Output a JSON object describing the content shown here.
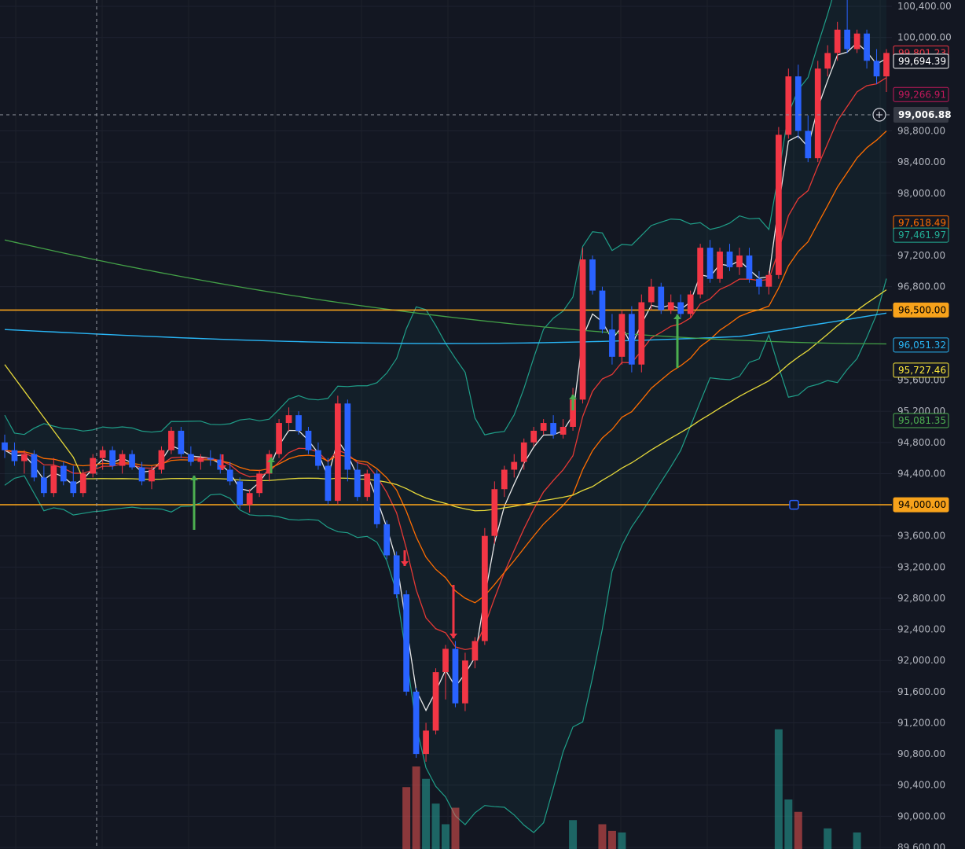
{
  "chart_data": {
    "type": "candlestick",
    "y_axis": {
      "min": 89600,
      "max": 100500,
      "ticks": [
        "100,400.00",
        "100,000.00",
        "98,800.00",
        "98,400.00",
        "98,000.00",
        "97,200.00",
        "96,800.00",
        "95,600.00",
        "95,200.00",
        "94,800.00",
        "94,400.00",
        "93,600.00",
        "93,200.00",
        "92,800.00",
        "92,400.00",
        "92,000.00",
        "91,600.00",
        "91,200.00",
        "90,800.00",
        "90,400.00",
        "90,000.00",
        "89,600.00"
      ]
    },
    "crosshair": {
      "price": "99,006.88",
      "value": 99006.88
    },
    "horizontal_lines": [
      {
        "label": "96,500.00",
        "value": 96500,
        "color": "#f7a21b"
      },
      {
        "label": "94,000.00",
        "value": 94000,
        "color": "#f7a21b"
      }
    ],
    "price_tags": [
      {
        "label": "99,801.23",
        "value": 99801.23,
        "color": "#f23645",
        "style": "outline"
      },
      {
        "label": "99,694.39",
        "value": 99694.39,
        "color": "#ffffff",
        "style": "outline"
      },
      {
        "label": "99,266.91",
        "value": 99266.91,
        "color": "#c2185b",
        "style": "outline"
      },
      {
        "label": "97,618.49",
        "value": 97618.49,
        "color": "#ff6d00",
        "style": "outline"
      },
      {
        "label": "97,461.97",
        "value": 97461.97,
        "color": "#22ab94",
        "style": "outline"
      },
      {
        "label": "96,051.32",
        "value": 96051.32,
        "color": "#29b6f6",
        "style": "outline"
      },
      {
        "label": "95,727.46",
        "value": 95727.46,
        "color": "#ffeb3b",
        "style": "outline"
      },
      {
        "label": "95,081.35",
        "value": 95081.35,
        "color": "#4caf50",
        "style": "outline"
      }
    ],
    "candles": [
      {
        "o": 94800,
        "h": 94900,
        "l": 94600,
        "c": 94700
      },
      {
        "o": 94700,
        "h": 94800,
        "l": 94500,
        "c": 94560
      },
      {
        "o": 94560,
        "h": 94700,
        "l": 94400,
        "c": 94650
      },
      {
        "o": 94650,
        "h": 94700,
        "l": 94300,
        "c": 94350
      },
      {
        "o": 94350,
        "h": 94500,
        "l": 94100,
        "c": 94150
      },
      {
        "o": 94150,
        "h": 94600,
        "l": 94100,
        "c": 94500
      },
      {
        "o": 94500,
        "h": 94550,
        "l": 94250,
        "c": 94300
      },
      {
        "o": 94300,
        "h": 94500,
        "l": 94100,
        "c": 94150
      },
      {
        "o": 94150,
        "h": 94450,
        "l": 94100,
        "c": 94400
      },
      {
        "o": 94400,
        "h": 94650,
        "l": 94350,
        "c": 94600
      },
      {
        "o": 94600,
        "h": 94750,
        "l": 94450,
        "c": 94700
      },
      {
        "o": 94700,
        "h": 94750,
        "l": 94450,
        "c": 94500
      },
      {
        "o": 94500,
        "h": 94700,
        "l": 94400,
        "c": 94650
      },
      {
        "o": 94650,
        "h": 94700,
        "l": 94450,
        "c": 94480
      },
      {
        "o": 94480,
        "h": 94550,
        "l": 94250,
        "c": 94300
      },
      {
        "o": 94300,
        "h": 94500,
        "l": 94200,
        "c": 94450
      },
      {
        "o": 94450,
        "h": 94750,
        "l": 94400,
        "c": 94700
      },
      {
        "o": 94700,
        "h": 95000,
        "l": 94650,
        "c": 94950
      },
      {
        "o": 94950,
        "h": 95000,
        "l": 94600,
        "c": 94650
      },
      {
        "o": 94650,
        "h": 94750,
        "l": 94500,
        "c": 94550
      },
      {
        "o": 94550,
        "h": 94650,
        "l": 94450,
        "c": 94600
      },
      {
        "o": 94600,
        "h": 94700,
        "l": 94500,
        "c": 94580
      },
      {
        "o": 94580,
        "h": 94650,
        "l": 94400,
        "c": 94450
      },
      {
        "o": 94450,
        "h": 94550,
        "l": 94250,
        "c": 94300
      },
      {
        "o": 94300,
        "h": 94350,
        "l": 93950,
        "c": 94000
      },
      {
        "o": 94000,
        "h": 94200,
        "l": 93900,
        "c": 94150
      },
      {
        "o": 94150,
        "h": 94450,
        "l": 94100,
        "c": 94400
      },
      {
        "o": 94400,
        "h": 94700,
        "l": 94300,
        "c": 94650
      },
      {
        "o": 94650,
        "h": 95100,
        "l": 94600,
        "c": 95050
      },
      {
        "o": 95050,
        "h": 95250,
        "l": 94950,
        "c": 95150
      },
      {
        "o": 95150,
        "h": 95200,
        "l": 94900,
        "c": 94950
      },
      {
        "o": 94950,
        "h": 95000,
        "l": 94650,
        "c": 94700
      },
      {
        "o": 94700,
        "h": 94800,
        "l": 94450,
        "c": 94500
      },
      {
        "o": 94500,
        "h": 94600,
        "l": 94000,
        "c": 94050
      },
      {
        "o": 94050,
        "h": 95400,
        "l": 94000,
        "c": 95300
      },
      {
        "o": 95300,
        "h": 95350,
        "l": 94300,
        "c": 94450
      },
      {
        "o": 94450,
        "h": 94550,
        "l": 94050,
        "c": 94100
      },
      {
        "o": 94100,
        "h": 94450,
        "l": 94050,
        "c": 94400
      },
      {
        "o": 94400,
        "h": 94450,
        "l": 93700,
        "c": 93750
      },
      {
        "o": 93750,
        "h": 93800,
        "l": 93300,
        "c": 93350
      },
      {
        "o": 93350,
        "h": 93400,
        "l": 92800,
        "c": 92850
      },
      {
        "o": 92850,
        "h": 92900,
        "l": 91550,
        "c": 91600
      },
      {
        "o": 91600,
        "h": 91650,
        "l": 90750,
        "c": 90800
      },
      {
        "o": 90800,
        "h": 91200,
        "l": 90700,
        "c": 91100
      },
      {
        "o": 91100,
        "h": 91900,
        "l": 91050,
        "c": 91850
      },
      {
        "o": 91850,
        "h": 92200,
        "l": 91500,
        "c": 92150
      },
      {
        "o": 92150,
        "h": 92250,
        "l": 91400,
        "c": 91450
      },
      {
        "o": 91450,
        "h": 92100,
        "l": 91350,
        "c": 92000
      },
      {
        "o": 92000,
        "h": 92300,
        "l": 91900,
        "c": 92250
      },
      {
        "o": 92250,
        "h": 93700,
        "l": 92200,
        "c": 93600
      },
      {
        "o": 93600,
        "h": 94300,
        "l": 93500,
        "c": 94200
      },
      {
        "o": 94200,
        "h": 94500,
        "l": 94100,
        "c": 94450
      },
      {
        "o": 94450,
        "h": 94650,
        "l": 94350,
        "c": 94550
      },
      {
        "o": 94550,
        "h": 94850,
        "l": 94450,
        "c": 94800
      },
      {
        "o": 94800,
        "h": 95000,
        "l": 94750,
        "c": 94950
      },
      {
        "o": 94950,
        "h": 95100,
        "l": 94900,
        "c": 95050
      },
      {
        "o": 95050,
        "h": 95150,
        "l": 94850,
        "c": 94900
      },
      {
        "o": 94900,
        "h": 95100,
        "l": 94850,
        "c": 95000
      },
      {
        "o": 95000,
        "h": 95500,
        "l": 94950,
        "c": 95350
      },
      {
        "o": 95350,
        "h": 97300,
        "l": 95300,
        "c": 97150
      },
      {
        "o": 97150,
        "h": 97200,
        "l": 96700,
        "c": 96750
      },
      {
        "o": 96750,
        "h": 96800,
        "l": 96200,
        "c": 96250
      },
      {
        "o": 96250,
        "h": 96450,
        "l": 95800,
        "c": 95900
      },
      {
        "o": 95900,
        "h": 96500,
        "l": 95800,
        "c": 96450
      },
      {
        "o": 96450,
        "h": 96550,
        "l": 95700,
        "c": 95800
      },
      {
        "o": 95800,
        "h": 96700,
        "l": 95700,
        "c": 96600
      },
      {
        "o": 96600,
        "h": 96900,
        "l": 96500,
        "c": 96800
      },
      {
        "o": 96800,
        "h": 96850,
        "l": 96450,
        "c": 96500
      },
      {
        "o": 96500,
        "h": 96700,
        "l": 96450,
        "c": 96600
      },
      {
        "o": 96600,
        "h": 96700,
        "l": 96400,
        "c": 96450
      },
      {
        "o": 96450,
        "h": 96750,
        "l": 96400,
        "c": 96700
      },
      {
        "o": 96700,
        "h": 97350,
        "l": 96650,
        "c": 97300
      },
      {
        "o": 97300,
        "h": 97400,
        "l": 96850,
        "c": 96900
      },
      {
        "o": 96900,
        "h": 97300,
        "l": 96850,
        "c": 97250
      },
      {
        "o": 97250,
        "h": 97350,
        "l": 97000,
        "c": 97050
      },
      {
        "o": 97050,
        "h": 97300,
        "l": 96950,
        "c": 97200
      },
      {
        "o": 97200,
        "h": 97300,
        "l": 96850,
        "c": 96900
      },
      {
        "o": 96900,
        "h": 97000,
        "l": 96700,
        "c": 96800
      },
      {
        "o": 96800,
        "h": 97000,
        "l": 96700,
        "c": 96950
      },
      {
        "o": 96950,
        "h": 98850,
        "l": 96900,
        "c": 98750
      },
      {
        "o": 98750,
        "h": 99600,
        "l": 98700,
        "c": 99500
      },
      {
        "o": 99500,
        "h": 99650,
        "l": 98700,
        "c": 98800
      },
      {
        "o": 98800,
        "h": 99000,
        "l": 98400,
        "c": 98450
      },
      {
        "o": 98450,
        "h": 99700,
        "l": 98400,
        "c": 99600
      },
      {
        "o": 99600,
        "h": 99900,
        "l": 99500,
        "c": 99800
      },
      {
        "o": 99800,
        "h": 100200,
        "l": 99700,
        "c": 100100
      },
      {
        "o": 100100,
        "h": 100500,
        "l": 99800,
        "c": 99850
      },
      {
        "o": 99850,
        "h": 100100,
        "l": 99800,
        "c": 100050
      },
      {
        "o": 100050,
        "h": 100100,
        "l": 99600,
        "c": 99700
      },
      {
        "o": 99700,
        "h": 99850,
        "l": 99400,
        "c": 99500
      },
      {
        "o": 99500,
        "h": 99850,
        "l": 99300,
        "c": 99801
      }
    ]
  },
  "annotations": {
    "crosshair_icon": "plus-circle-icon",
    "handle_icon": "square-handle-icon"
  }
}
